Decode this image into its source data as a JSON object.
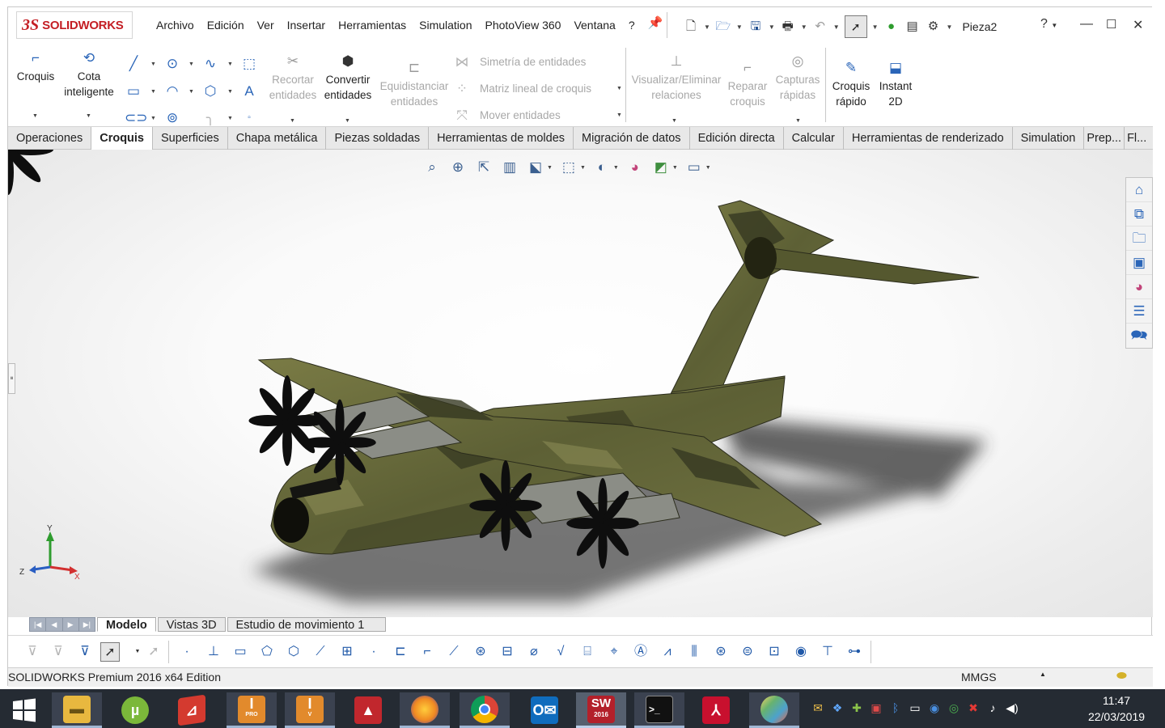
{
  "app": {
    "brand_mark": "3S",
    "brand_name": "SOLIDWORKS",
    "document_title": "Pieza2"
  },
  "menu": [
    "Archivo",
    "Edición",
    "Ver",
    "Insertar",
    "Herramientas",
    "Simulation",
    "PhotoView 360",
    "Ventana",
    "?"
  ],
  "quick_access": {
    "help_label": "?"
  },
  "ribbon": {
    "croquis": "Croquis",
    "cota_1": "Cota",
    "cota_2": "inteligente",
    "recortar_1": "Recortar",
    "recortar_2": "entidades",
    "convertir_1": "Convertir",
    "convertir_2": "entidades",
    "equidistanciar_1": "Equidistanciar",
    "equidistanciar_2": "entidades",
    "simetria": "Simetría de entidades",
    "matriz": "Matriz lineal de croquis",
    "mover": "Mover entidades",
    "visualizar_1": "Visualizar/Eliminar",
    "visualizar_2": "relaciones",
    "reparar_1": "Reparar",
    "reparar_2": "croquis",
    "capturas_1": "Capturas",
    "capturas_2": "rápidas",
    "croquis_rapido_1": "Croquis",
    "croquis_rapido_2": "rápido",
    "instant_1": "Instant",
    "instant_2": "2D"
  },
  "tabs": [
    "Operaciones",
    "Croquis",
    "Superficies",
    "Chapa metálica",
    "Piezas soldadas",
    "Herramientas de moldes",
    "Migración de datos",
    "Edición directa",
    "Calcular",
    "Herramientas de renderizado",
    "Simulation",
    "Prep...",
    "Fl..."
  ],
  "active_tab": "Croquis",
  "triad": {
    "x": "X",
    "y": "Y",
    "z": "Z"
  },
  "bottom_tabs": [
    "Modelo",
    "Vistas 3D",
    "Estudio de movimiento 1"
  ],
  "status": {
    "edition": "SOLIDWORKS Premium 2016 x64 Edition",
    "units": "MMGS"
  },
  "clock": {
    "time": "11:47",
    "date": "22/03/2019"
  },
  "taskbar_apps": [
    "start",
    "file-explorer",
    "utorrent",
    "sketchup",
    "inventor-pro",
    "inventor-view",
    "autocad",
    "firefox",
    "chrome",
    "outlook",
    "solidworks-2016",
    "command-prompt",
    "acrobat",
    "paint"
  ],
  "taskbar_labels": {
    "inventor_pro": "PRO",
    "inventor_v": "V",
    "sw": "SW",
    "sw_year": "2016"
  },
  "colors": {
    "brand_red": "#c41e24",
    "accent_blue": "#2a65b8",
    "camo_green": "#6b6e3e",
    "camo_dark": "#363822",
    "taskbar": "#252b33"
  }
}
